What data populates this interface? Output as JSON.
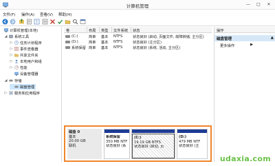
{
  "window": {
    "title": "计算机管理"
  },
  "window_controls": {
    "minimize": "—",
    "maximize": "□",
    "close": "✕"
  },
  "menu": [
    "文件(F)",
    "操作(A)",
    "查看(V)",
    "帮助(H)"
  ],
  "tree": {
    "root": "计算机管理(本地)",
    "items": [
      {
        "label": "系统工具",
        "level": 1,
        "arrow": "◢"
      },
      {
        "label": "任务计划程序",
        "level": 2,
        "arrow": "▷"
      },
      {
        "label": "事件查看器",
        "level": 2,
        "arrow": "▷"
      },
      {
        "label": "共享文件夹",
        "level": 2,
        "arrow": "▷"
      },
      {
        "label": "本地用户和组",
        "level": 2,
        "arrow": "▷"
      },
      {
        "label": "性能",
        "level": 2,
        "arrow": "▷"
      },
      {
        "label": "设备管理器",
        "level": 2,
        "arrow": ""
      },
      {
        "label": "存储",
        "level": 1,
        "arrow": "◢"
      },
      {
        "label": "磁盘管理",
        "level": 2,
        "arrow": "",
        "selected": true
      },
      {
        "label": "服务和应用程序",
        "level": 1,
        "arrow": "▷"
      }
    ]
  },
  "volume_list": {
    "columns": [
      "卷",
      "布局",
      "类型",
      "文件系统",
      "状态"
    ],
    "rows": [
      {
        "volume": "(C:)",
        "layout": "简单",
        "type": "基本",
        "fs": "NTFS",
        "status": "状态良好 (启动, 页面文件, 故障转储, 主分区)"
      },
      {
        "volume": "(D:)",
        "layout": "简单",
        "type": "基本",
        "fs": "NTFS",
        "status": "状态良好 (主分区)"
      },
      {
        "volume": "系统保留",
        "layout": "简单",
        "type": "基本",
        "fs": "NTFS",
        "status": "状态良好 (系统, 活动, 主分区)"
      }
    ]
  },
  "disk": {
    "name": "磁盘 0",
    "kind": "基本",
    "size": "20.00 GB",
    "state": "联机",
    "partitions": [
      {
        "name": "系统保留",
        "size": "350 MB NTF",
        "status": "状态良好 (系",
        "hatched": false
      },
      {
        "name": "(C:)",
        "size": "19.19 GB NTFS",
        "status": "状态良好 (启动, 页",
        "hatched": true
      },
      {
        "name": "(D:)",
        "size": "479 MB NTF",
        "status": "状态良好 (主",
        "hatched": false
      }
    ]
  },
  "actions": {
    "header": "操作",
    "section": "磁盘管理",
    "more": "更多操作",
    "caret_up": "▲",
    "caret_right": "▶"
  },
  "watermark": "udaxia.com",
  "colors": {
    "partition_bar": "#1d3b95",
    "selection": "#cce8ff",
    "action_section": "#d6e8f8",
    "highlight_border": "#f0842b",
    "watermark": "#6cc24a"
  },
  "icons": [
    "app-icon",
    "back-icon",
    "forward-icon",
    "up-icon",
    "properties-icon",
    "help-icon",
    "list-view-icon",
    "delete-icon",
    "checkmark-icon",
    "folder-open-icon",
    "search-icon",
    "view-icon",
    "computer-icon",
    "tools-icon",
    "disk-icon"
  ]
}
